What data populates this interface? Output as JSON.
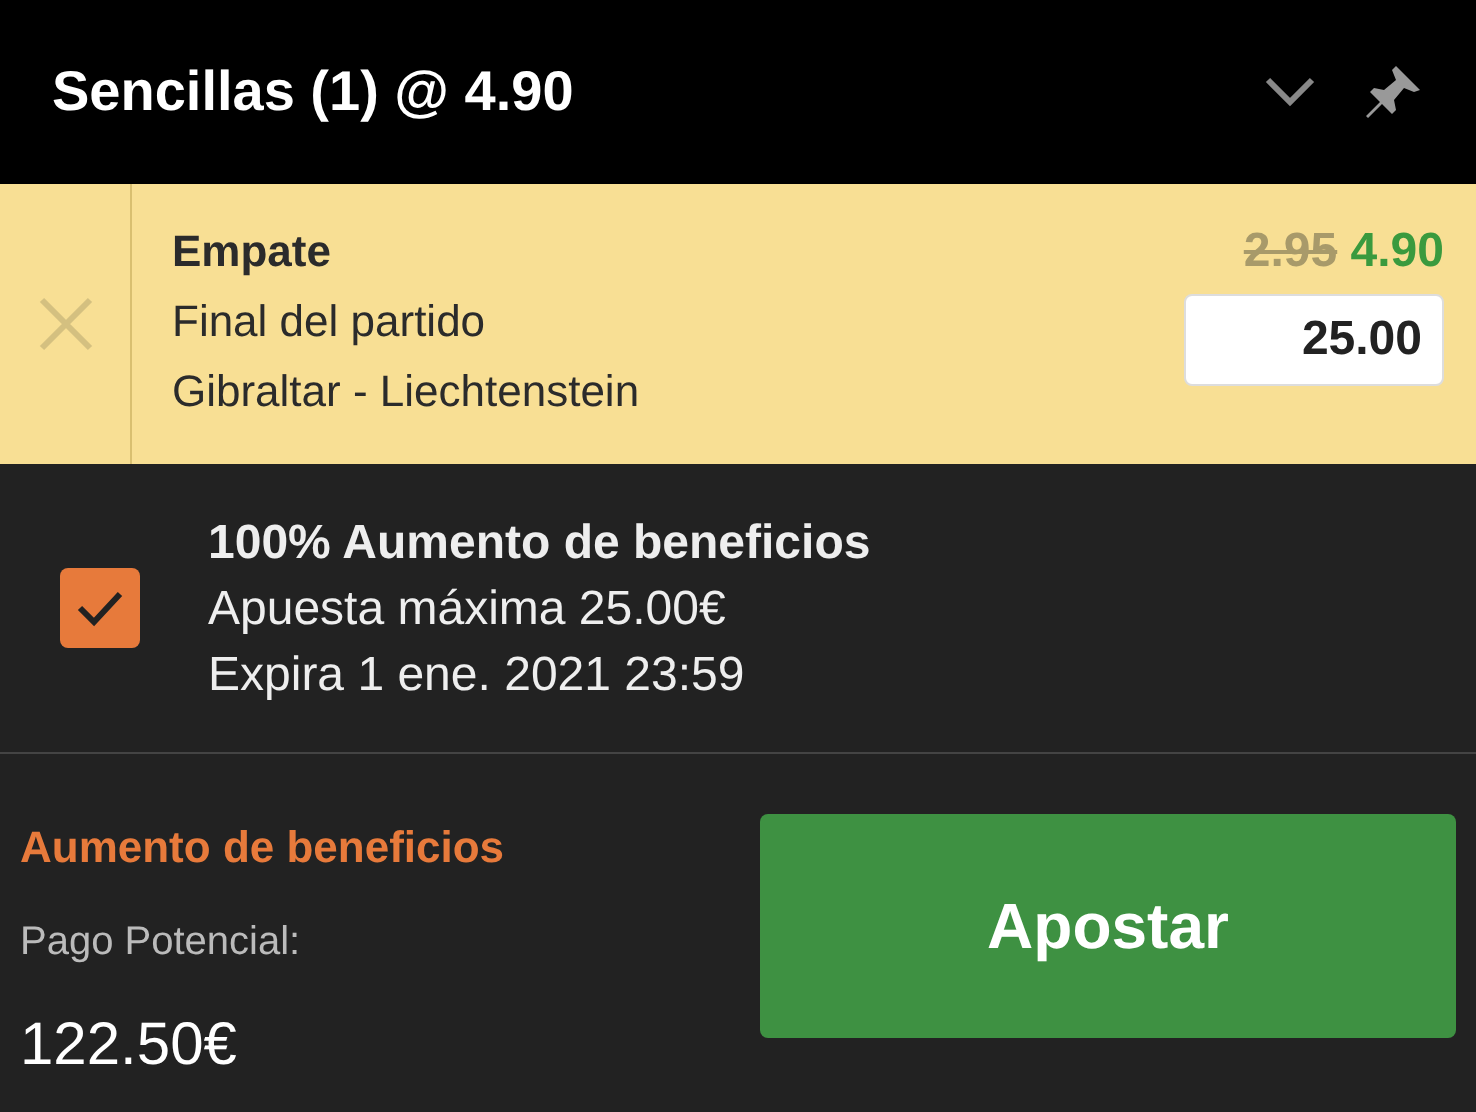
{
  "header": {
    "title": "Sencillas (1) @ 4.90"
  },
  "selection": {
    "market_choice": "Empate",
    "market": "Final del partido",
    "event": "Gibraltar - Liechtenstein",
    "old_odds": "2.95",
    "new_odds": "4.90",
    "stake": "25.00"
  },
  "promo": {
    "checked": true,
    "title": "100% Aumento de beneficios",
    "max_stake": "Apuesta máxima 25.00€",
    "expiry": "Expira 1 ene. 2021 23:59"
  },
  "footer": {
    "boost_label": "Aumento de beneficios",
    "payout_label": "Pago Potencial:",
    "payout": "122.50€",
    "button": "Apostar"
  }
}
